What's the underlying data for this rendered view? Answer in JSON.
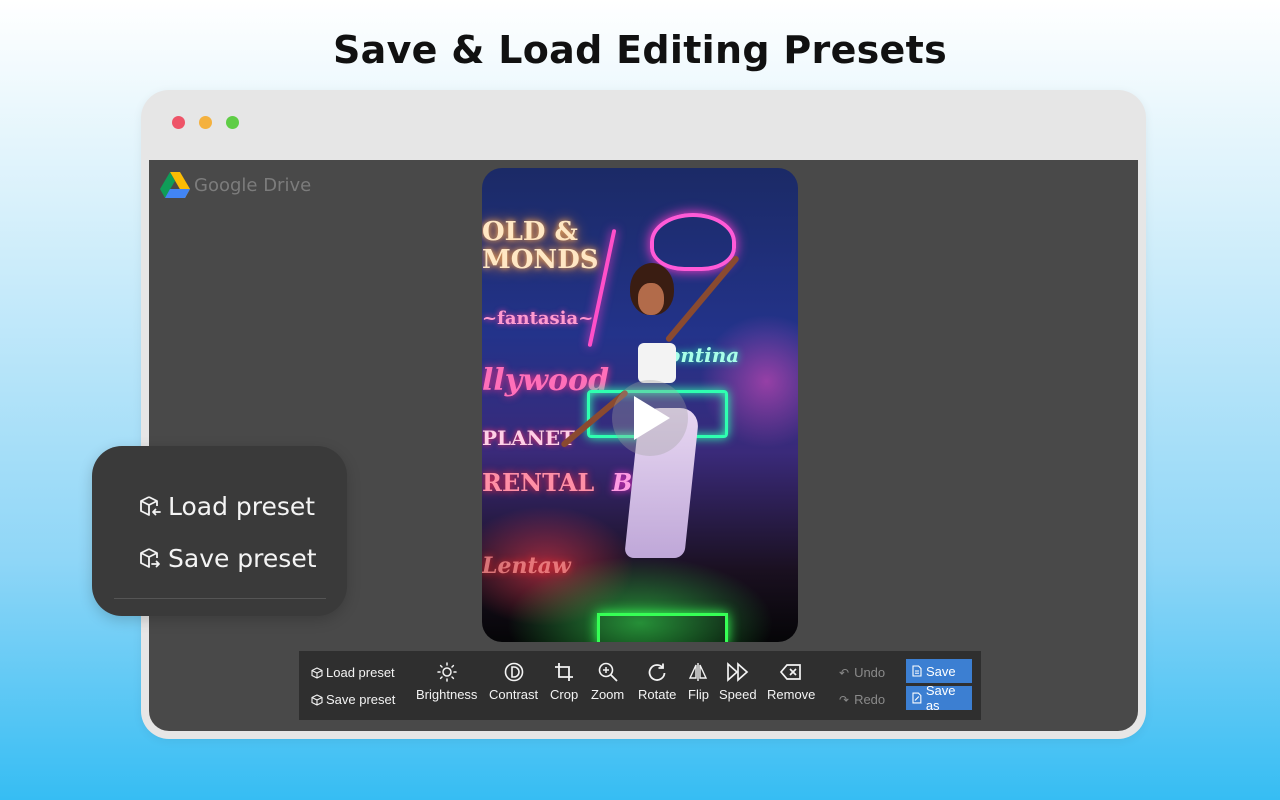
{
  "headline": "Save & Load Editing Presets",
  "browser": {
    "dots": [
      "red",
      "yellow",
      "green"
    ],
    "colors": {
      "red": "#ee5468",
      "yellow": "#f4b13e",
      "green": "#5fcd46"
    }
  },
  "brand": {
    "text": "Google Drive",
    "icon": "google-drive-icon"
  },
  "video": {
    "state": "paused",
    "play_icon": "play-icon"
  },
  "toolbar": {
    "load_preset": "Load preset",
    "save_preset": "Save preset",
    "tools": [
      {
        "label": "Brightness",
        "icon": "brightness-icon"
      },
      {
        "label": "Contrast",
        "icon": "contrast-icon"
      },
      {
        "label": "Crop",
        "icon": "crop-icon"
      },
      {
        "label": "Zoom",
        "icon": "zoom-icon"
      },
      {
        "label": "Rotate",
        "icon": "rotate-icon"
      },
      {
        "label": "Flip",
        "icon": "flip-icon"
      },
      {
        "label": "Speed",
        "icon": "speed-icon"
      },
      {
        "label": "Remove",
        "icon": "remove-icon"
      }
    ],
    "undo": "Undo",
    "redo": "Redo",
    "save": "Save",
    "save_as": "Save as",
    "accent": "#3c7fd2"
  },
  "popup": {
    "load_preset": "Load preset",
    "save_preset": "Save preset"
  }
}
